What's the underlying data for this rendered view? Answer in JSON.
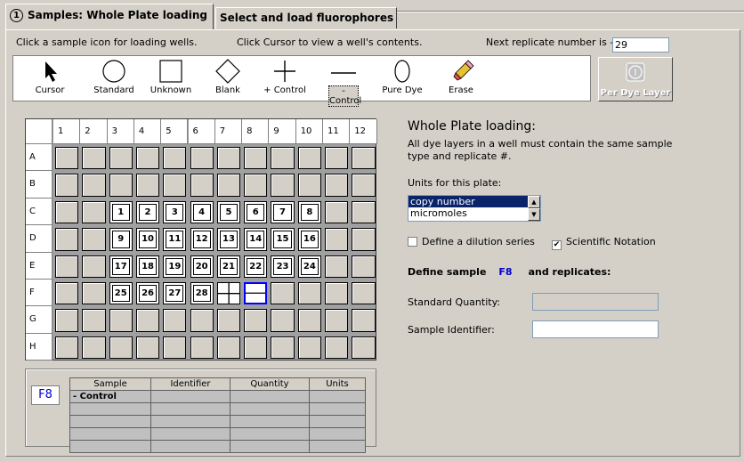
{
  "tabs": [
    {
      "num": "1",
      "label": "Samples: Whole Plate loading"
    },
    {
      "label": "Select and load fluorophores"
    }
  ],
  "hints": {
    "click_sample": "Click a sample icon for loading wells.",
    "click_cursor": "Click Cursor to view a well's contents.",
    "next_replicate": "Next replicate number is   ----->",
    "next_replicate_value": "29"
  },
  "tools": [
    {
      "label": "Cursor",
      "icon": "cursor-arrow-icon"
    },
    {
      "label": "Standard",
      "icon": "circle-icon"
    },
    {
      "label": "Unknown",
      "icon": "square-icon"
    },
    {
      "label": "Blank",
      "icon": "diamond-icon"
    },
    {
      "label": "+ Control",
      "icon": "plus-icon"
    },
    {
      "label": "- Control",
      "icon": "minus-icon",
      "selected": true
    },
    {
      "label": "Pure Dye",
      "icon": "ellipse-icon"
    },
    {
      "label": "Erase",
      "icon": "pencil-eraser-icon"
    }
  ],
  "per_dye_layer": "Per Dye Layer",
  "plate": {
    "columns": [
      "1",
      "2",
      "3",
      "4",
      "5",
      "6",
      "7",
      "8",
      "9",
      "10",
      "11",
      "12"
    ],
    "rows": [
      "A",
      "B",
      "C",
      "D",
      "E",
      "F",
      "G",
      "H"
    ],
    "wells": {
      "C3": "1",
      "C4": "2",
      "C5": "3",
      "C6": "4",
      "C7": "5",
      "C8": "6",
      "C9": "7",
      "C10": "8",
      "D3": "9",
      "D4": "10",
      "D5": "11",
      "D6": "12",
      "D7": "13",
      "D8": "14",
      "D9": "15",
      "D10": "16",
      "E3": "17",
      "E4": "18",
      "E5": "19",
      "E6": "20",
      "E7": "21",
      "E8": "22",
      "E9": "23",
      "E10": "24",
      "F3": "25",
      "F4": "26",
      "F5": "27",
      "F6": "28"
    },
    "symbol_wells": {
      "F7": "plus",
      "F8": "minus"
    },
    "selected_well": "F8"
  },
  "settings": {
    "title": "Whole Plate loading:",
    "description": "All dye layers in a well must contain the same sample type and replicate #.",
    "units_label": "Units for this plate:",
    "units_options": [
      "copy number",
      "micromoles"
    ],
    "units_selected": "copy number",
    "dilution_label": "Define a dilution series",
    "dilution_checked": false,
    "sci_label": "Scientific Notation",
    "sci_checked": true,
    "define_prefix": "Define sample",
    "define_well": "F8",
    "define_suffix": "and replicates:",
    "std_qty_label": "Standard Quantity:",
    "sample_id_label": "Sample Identifier:"
  },
  "summary": {
    "well": "F8",
    "headers": [
      "Sample",
      "Identifier",
      "Quantity",
      "Units"
    ],
    "rows": [
      [
        "- Control",
        "",
        "",
        ""
      ],
      [
        "",
        "",
        "",
        ""
      ],
      [
        "",
        "",
        "",
        ""
      ],
      [
        "",
        "",
        "",
        ""
      ],
      [
        "",
        "",
        "",
        ""
      ]
    ]
  }
}
